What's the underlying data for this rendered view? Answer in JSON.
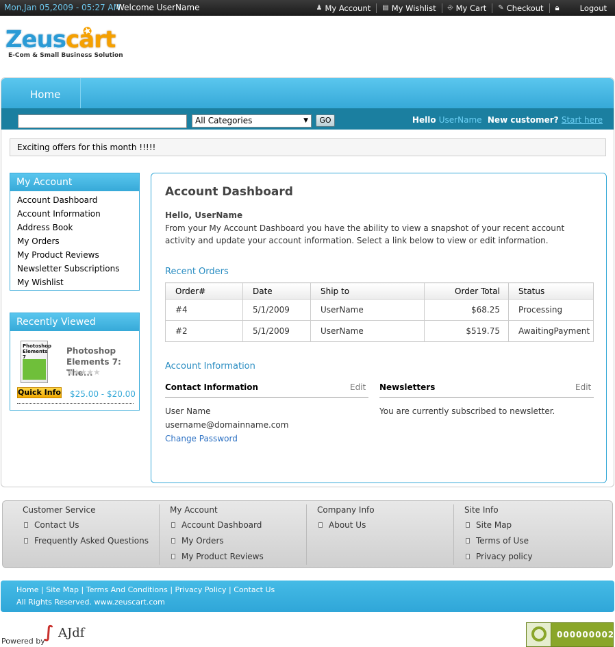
{
  "topbar": {
    "date": "Mon,Jan 05,2009 - 05:27 AM",
    "welcome": "Welcome UserName",
    "links": [
      {
        "label": "My Account",
        "icon": "user-icon"
      },
      {
        "label": "My Wishlist",
        "icon": "list-icon"
      },
      {
        "label": "My Cart",
        "icon": "cart-icon"
      },
      {
        "label": "Checkout",
        "icon": "checkout-icon"
      },
      {
        "label": "",
        "icon": "lock-icon"
      },
      {
        "label": "Logout",
        "icon": ""
      }
    ]
  },
  "logo": {
    "name_part1": "Zeus",
    "name_part2": "cart",
    "tagline": "E-Com & Small Business Solution"
  },
  "nav": {
    "home": "Home"
  },
  "search": {
    "value": "",
    "category": "All Categories",
    "go": "GO",
    "hello": "Hello",
    "username": "UserName",
    "new_customer": "New customer?",
    "start_here": "Start here"
  },
  "offers": "Exciting offers for this month !!!!!",
  "sidebar": {
    "account_title": "My Account",
    "account_items": [
      "Account Dashboard",
      "Account Information",
      "Address Book",
      "My Orders",
      "My Product Reviews",
      "Newsletter Subscriptions",
      "My Wishlist"
    ],
    "recent_title": "Recently Viewed",
    "recent_item": {
      "book_title": "Photoshop Elements 7",
      "title": "Photoshop Elements 7: The...",
      "rating": 0,
      "quick_info": "Quick Info",
      "price": "$25.00 - $20.00"
    }
  },
  "main": {
    "title": "Account Dashboard",
    "hello_name": "Hello, UserName",
    "intro": "From your My Account Dashboard you have the ability to view a snapshot of your recent account activity and update your account information. Select a link below to view or edit information.",
    "recent_orders_title": "Recent Orders",
    "orders_headers": [
      "Order#",
      "Date",
      "Ship to",
      "Order Total",
      "Status"
    ],
    "orders": [
      [
        "#4",
        "5/1/2009",
        "UserName",
        "$68.25",
        "Processing"
      ],
      [
        "#2",
        "5/1/2009",
        "UserName",
        "$519.75",
        "AwaitingPayment"
      ]
    ],
    "account_info_title": "Account Information",
    "contact_title": "Contact Information",
    "contact_edit": "Edit",
    "newsletters_title": "Newsletters",
    "newsletters_edit": "Edit",
    "contact_name": "User Name",
    "contact_email": "username@domainname.com",
    "change_password": "Change Password",
    "newsletter_status": "You are currently subscribed to newsletter."
  },
  "footer": {
    "columns": [
      {
        "title": "Customer Service",
        "items": [
          "Contact Us",
          "Frequently Asked Questions"
        ]
      },
      {
        "title": "My Account",
        "items": [
          "Account Dashboard",
          "My Orders",
          "My Product Reviews"
        ]
      },
      {
        "title": "Company Info",
        "items": [
          "About Us"
        ]
      },
      {
        "title": "Site Info",
        "items": [
          "Site Map",
          "Terms of Use",
          "Privacy policy"
        ]
      }
    ],
    "links": [
      "Home",
      "Site Map",
      "Terms And Conditions",
      "Privacy Policy",
      "Contact Us"
    ],
    "rights": "All Rights Reserved. www.zeuscart.com",
    "powered_by": "Powered by",
    "ajdf": "AJdf",
    "counter": "000000002"
  },
  "colors": {
    "accent": "#36a9d8",
    "dark_band": "#1b7fa0",
    "topbar": "#222222",
    "quick_info": "#f5b800",
    "counter": "#8aa62a"
  }
}
